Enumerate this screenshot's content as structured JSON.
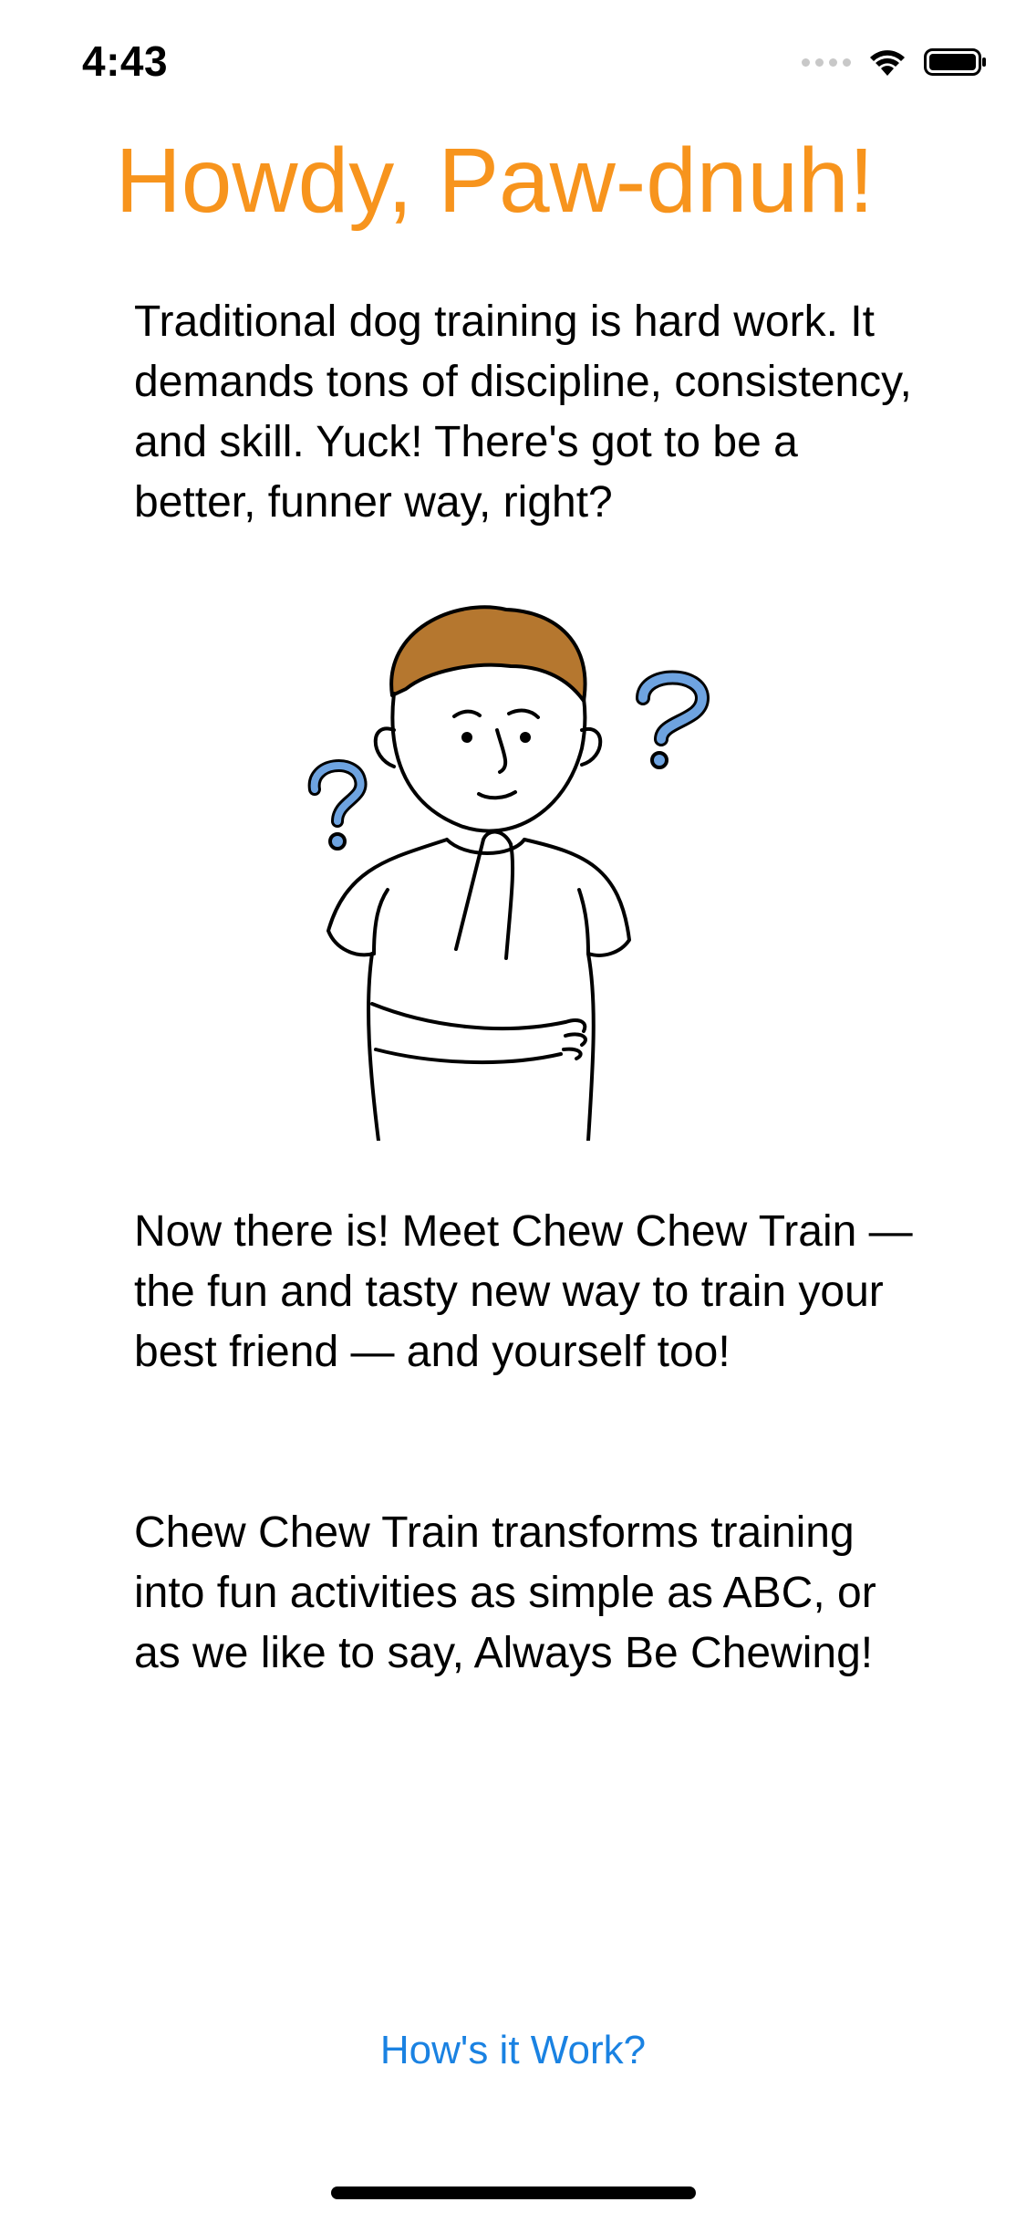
{
  "status_bar": {
    "time": "4:43",
    "icons": [
      "signal-dots-icon",
      "wifi-icon",
      "battery-icon"
    ]
  },
  "header": {
    "title": "Howdy, Paw-dnuh!"
  },
  "content": {
    "intro": "Traditional dog training is hard work. It demands tons of discipline, consistency, and skill. Yuck! There's got to be a better, funner way, right?",
    "illustration": "thinking-person-illustration",
    "pitch": "Now there is! Meet Chew Chew Train — the fun and tasty new way to train your best friend — and yourself too!",
    "abc": "Chew Chew Train transforms training into fun activities as simple as ABC, or as we like to say, Always Be Chewing!"
  },
  "actions": {
    "how_it_works": "How's it Work?"
  },
  "colors": {
    "title": "#f7941d",
    "link": "#1a82e2",
    "hair": "#b5772f",
    "question_marks": "#6ea3e0"
  }
}
